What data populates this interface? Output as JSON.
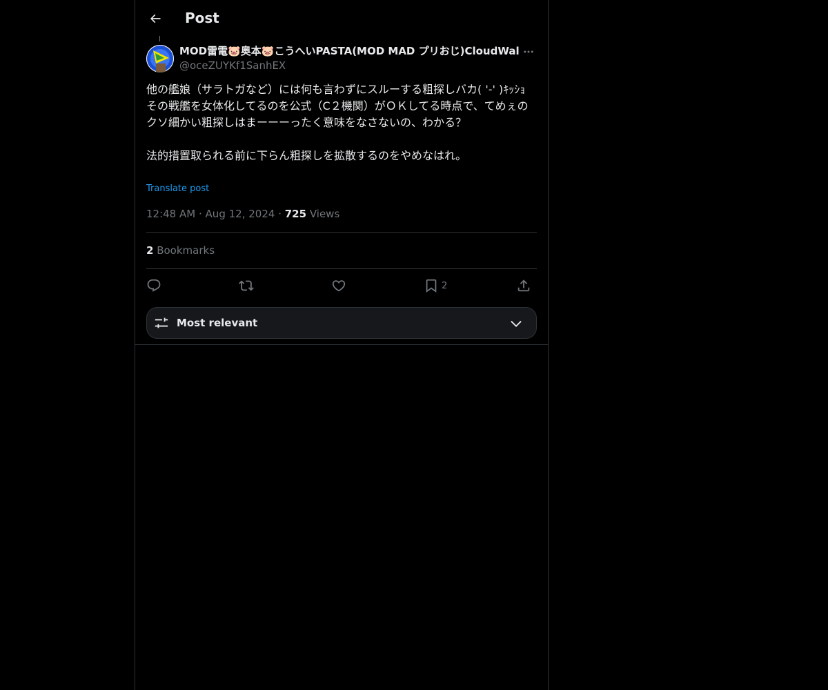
{
  "header": {
    "title": "Post",
    "back_icon": "arrow-left-icon"
  },
  "author": {
    "display_name": "MOD雷電🐷奥本🐷こうへいPASTA(MOD MAD プリおじ)CloudWalker 紅",
    "handle": "@oceZUYKf1SanhEX",
    "avatar_icon": "avatar-image"
  },
  "post": {
    "text": "他の艦娘（サラトガなど）には何も言わずにスルーする粗探しバカ( '-' )ｷｯｼｮ\nその戦艦を女体化してるのを公式（C２機関）がＯＫしてる時点で、てめぇのクソ細かい粗探しはまーーーったく意味をなさないの、わかる？\n\n法的措置取られる前に下らん粗探しを拡散するのをやめなはれ。",
    "translate_label": "Translate post",
    "time": "12:48 AM",
    "separator": "·",
    "date": "Aug 12, 2024",
    "views_count": "725",
    "views_label": "Views"
  },
  "stats": {
    "bookmarks_count": "2",
    "bookmarks_label": "Bookmarks"
  },
  "actions": {
    "reply_icon": "reply-icon",
    "repost_icon": "repost-icon",
    "like_icon": "like-icon",
    "bookmark_icon": "bookmark-icon",
    "bookmark_count": "2",
    "share_icon": "share-icon"
  },
  "replies_sort": {
    "label": "Most relevant",
    "icon": "sliders-icon",
    "chevron": "chevron-down-icon"
  },
  "colors": {
    "background": "#000000",
    "text": "#e7e9ea",
    "muted": "#71767b",
    "accent": "#1d9bf0",
    "border": "#2f3336"
  }
}
